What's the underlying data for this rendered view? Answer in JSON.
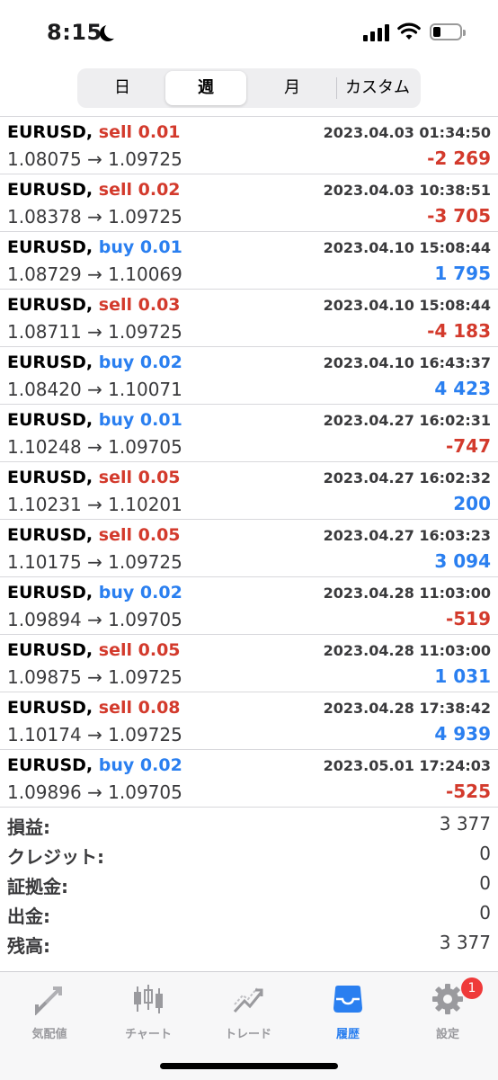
{
  "status_bar": {
    "time": "8:15"
  },
  "period_tabs": [
    {
      "label": "日",
      "active": false
    },
    {
      "label": "週",
      "active": true
    },
    {
      "label": "月",
      "active": false
    },
    {
      "label": "カスタム",
      "active": false
    }
  ],
  "colors": {
    "sell": "#d33a2c",
    "buy": "#2a7ff0",
    "loss": "#d33a2c",
    "gain": "#2a7ff0",
    "active_tab": "#2a7ff0",
    "badge": "#ef3a3a"
  },
  "trades": [
    {
      "symbol": "EURUSD,",
      "side": "sell",
      "volume": "0.01",
      "time": "2023.04.03 01:34:50",
      "prices": "1.08075 → 1.09725",
      "profit": "-2 269",
      "positive": false
    },
    {
      "symbol": "EURUSD,",
      "side": "sell",
      "volume": "0.02",
      "time": "2023.04.03 10:38:51",
      "prices": "1.08378 → 1.09725",
      "profit": "-3 705",
      "positive": false
    },
    {
      "symbol": "EURUSD,",
      "side": "buy",
      "volume": "0.01",
      "time": "2023.04.10 15:08:44",
      "prices": "1.08729 → 1.10069",
      "profit": "1 795",
      "positive": true
    },
    {
      "symbol": "EURUSD,",
      "side": "sell",
      "volume": "0.03",
      "time": "2023.04.10 15:08:44",
      "prices": "1.08711 → 1.09725",
      "profit": "-4 183",
      "positive": false
    },
    {
      "symbol": "EURUSD,",
      "side": "buy",
      "volume": "0.02",
      "time": "2023.04.10 16:43:37",
      "prices": "1.08420 → 1.10071",
      "profit": "4 423",
      "positive": true
    },
    {
      "symbol": "EURUSD,",
      "side": "buy",
      "volume": "0.01",
      "time": "2023.04.27 16:02:31",
      "prices": "1.10248 → 1.09705",
      "profit": "-747",
      "positive": false
    },
    {
      "symbol": "EURUSD,",
      "side": "sell",
      "volume": "0.05",
      "time": "2023.04.27 16:02:32",
      "prices": "1.10231 → 1.10201",
      "profit": "200",
      "positive": true
    },
    {
      "symbol": "EURUSD,",
      "side": "sell",
      "volume": "0.05",
      "time": "2023.04.27 16:03:23",
      "prices": "1.10175 → 1.09725",
      "profit": "3 094",
      "positive": true
    },
    {
      "symbol": "EURUSD,",
      "side": "buy",
      "volume": "0.02",
      "time": "2023.04.28 11:03:00",
      "prices": "1.09894 → 1.09705",
      "profit": "-519",
      "positive": false
    },
    {
      "symbol": "EURUSD,",
      "side": "sell",
      "volume": "0.05",
      "time": "2023.04.28 11:03:00",
      "prices": "1.09875 → 1.09725",
      "profit": "1 031",
      "positive": true
    },
    {
      "symbol": "EURUSD,",
      "side": "sell",
      "volume": "0.08",
      "time": "2023.04.28 17:38:42",
      "prices": "1.10174 → 1.09725",
      "profit": "4 939",
      "positive": true
    },
    {
      "symbol": "EURUSD,",
      "side": "buy",
      "volume": "0.02",
      "time": "2023.05.01 17:24:03",
      "prices": "1.09896 → 1.09705",
      "profit": "-525",
      "positive": false
    }
  ],
  "summary": [
    {
      "label": "損益:",
      "value": "3 377"
    },
    {
      "label": "クレジット:",
      "value": "0"
    },
    {
      "label": "証拠金:",
      "value": "0"
    },
    {
      "label": "出金:",
      "value": "0"
    },
    {
      "label": "残高:",
      "value": "3 377"
    }
  ],
  "tab_bar": [
    {
      "label": "気配値",
      "icon": "quotes-arrows-icon",
      "active": false,
      "badge": ""
    },
    {
      "label": "チャート",
      "icon": "candlestick-chart-icon",
      "active": false,
      "badge": ""
    },
    {
      "label": "トレード",
      "icon": "trade-line-icon",
      "active": false,
      "badge": ""
    },
    {
      "label": "履歴",
      "icon": "history-tray-icon",
      "active": true,
      "badge": ""
    },
    {
      "label": "設定",
      "icon": "gear-icon",
      "active": false,
      "badge": "1"
    }
  ]
}
